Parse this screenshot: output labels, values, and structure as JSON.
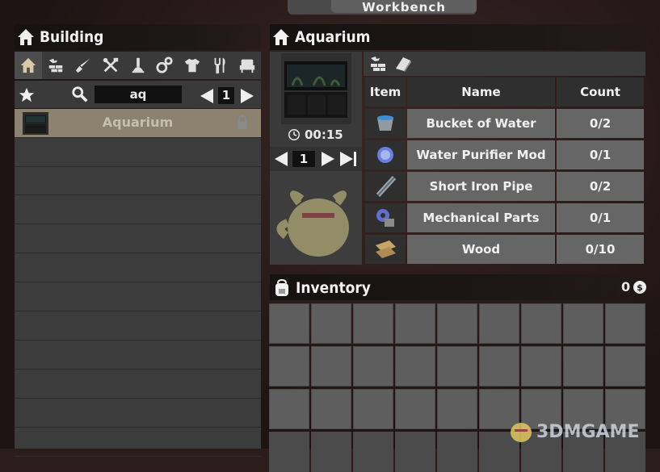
{
  "workbench": {
    "title": "Workbench"
  },
  "left_panel": {
    "title": "Building",
    "categories": [
      {
        "name": "home-icon"
      },
      {
        "name": "build-icon"
      },
      {
        "name": "weapons-icon"
      },
      {
        "name": "tools-icon"
      },
      {
        "name": "science-icon"
      },
      {
        "name": "parts-icon"
      },
      {
        "name": "clothing-icon"
      },
      {
        "name": "food-icon"
      },
      {
        "name": "furniture-icon"
      }
    ],
    "search": {
      "value": "aq"
    },
    "page": "1",
    "items": [
      {
        "label": "Aquarium",
        "locked": true
      }
    ]
  },
  "recipe": {
    "title": "Aquarium",
    "craft_time": "00:15",
    "quantity": "1",
    "table": {
      "headers": {
        "item": "Item",
        "name": "Name",
        "count": "Count"
      },
      "rows": [
        {
          "icon": "bucket-of-water-icon",
          "name": "Bucket of Water",
          "count": "0/2"
        },
        {
          "icon": "water-purifier-mod-icon",
          "name": "Water Purifier Mod",
          "count": "0/1"
        },
        {
          "icon": "short-iron-pipe-icon",
          "name": "Short Iron Pipe",
          "count": "0/2"
        },
        {
          "icon": "mechanical-parts-icon",
          "name": "Mechanical Parts",
          "count": "0/1"
        },
        {
          "icon": "wood-icon",
          "name": "Wood",
          "count": "0/10"
        }
      ]
    }
  },
  "inventory": {
    "title": "Inventory",
    "currency": "0"
  },
  "watermark": {
    "text": "3DMGAME"
  }
}
